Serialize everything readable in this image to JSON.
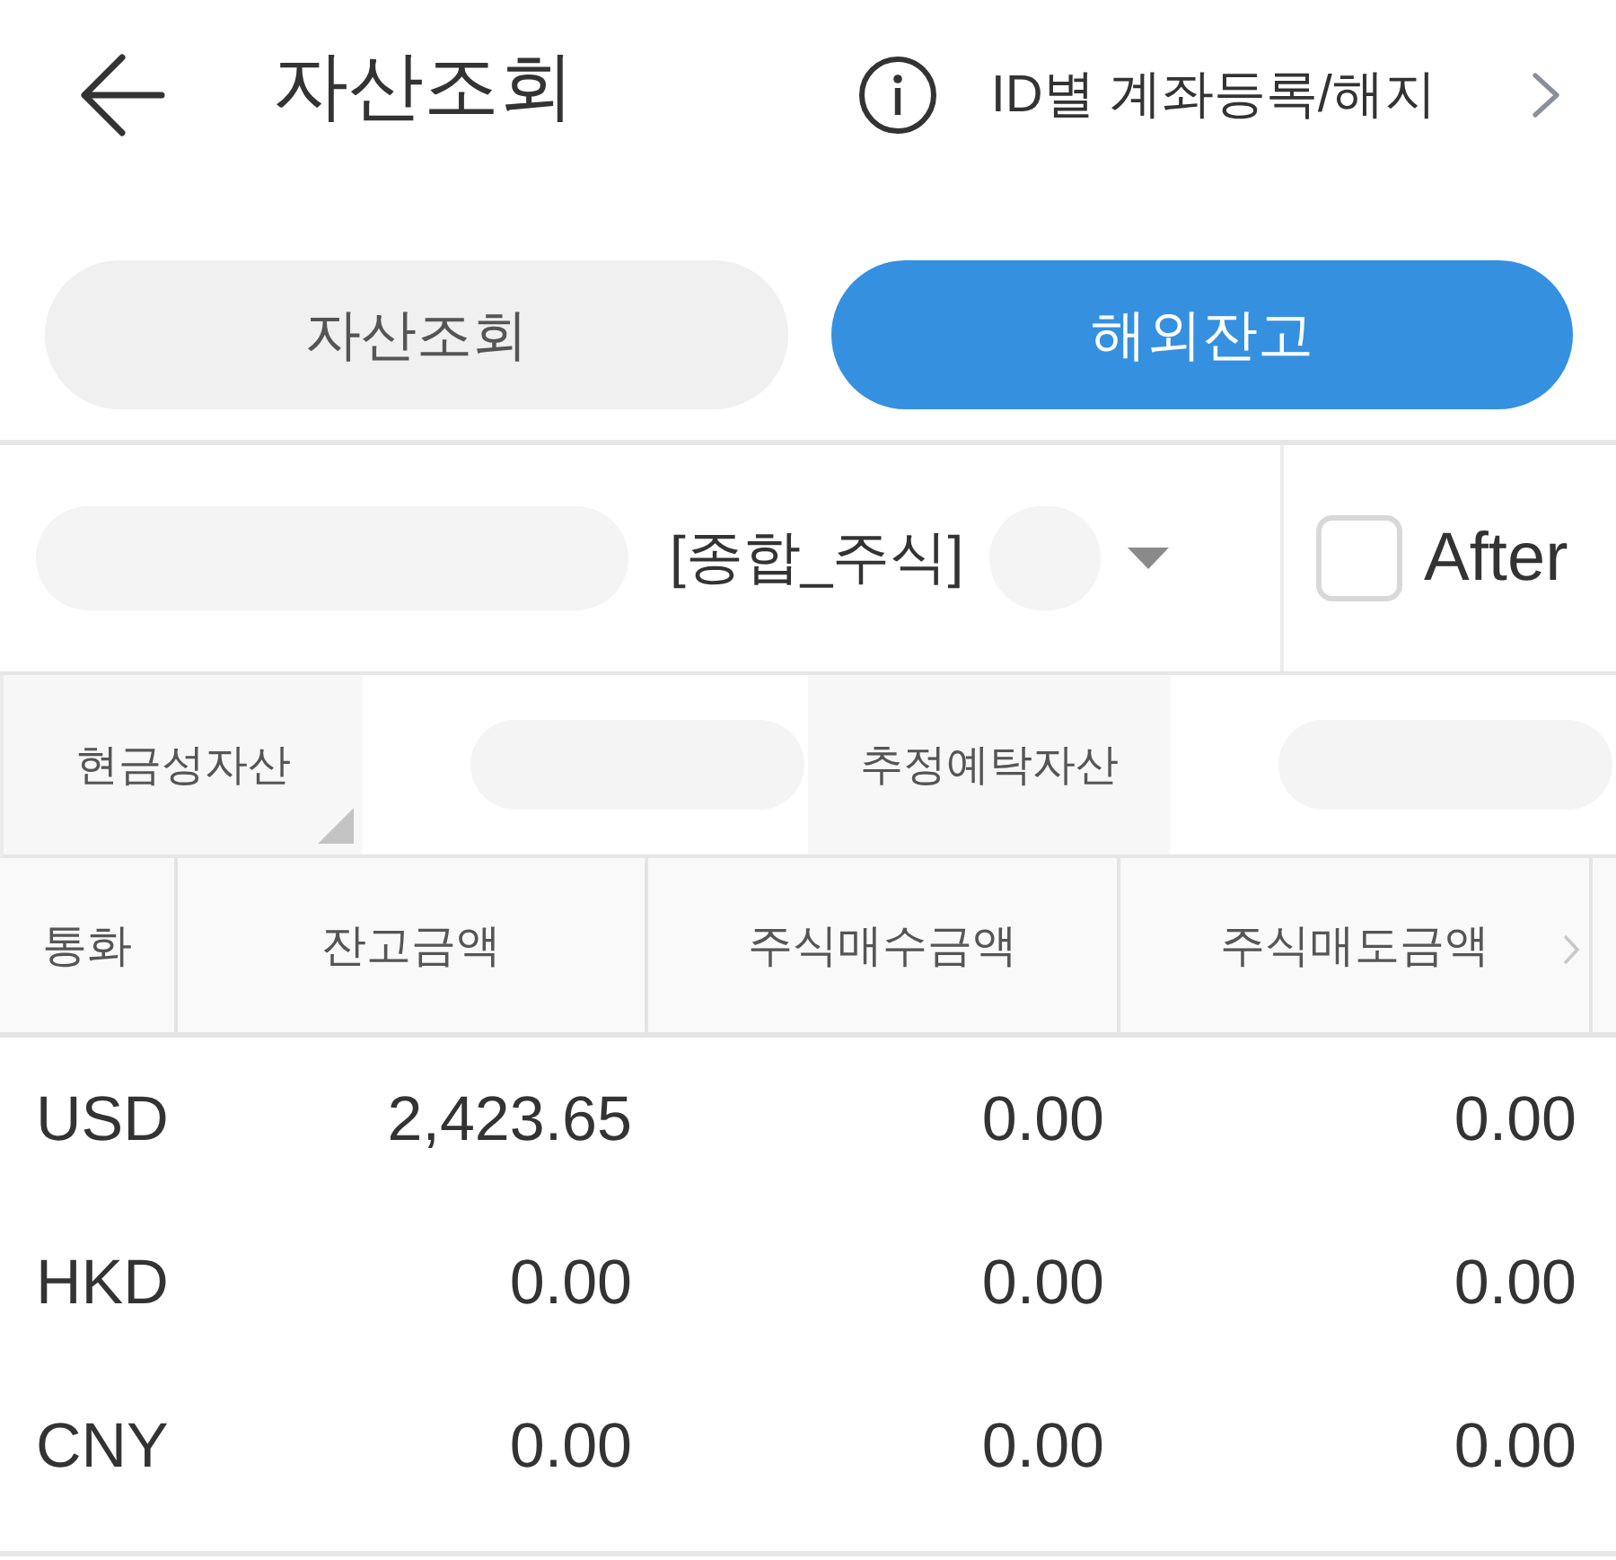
{
  "header": {
    "title": "자산조회",
    "link": "ID별 계좌등록/해지"
  },
  "tabs": [
    {
      "label": "자산조회",
      "selected": false
    },
    {
      "label": "해외잔고",
      "selected": true
    }
  ],
  "account": {
    "label": "[종합_주식]",
    "masked": true
  },
  "after": {
    "label": "After",
    "checked": false
  },
  "summary": [
    {
      "label": "현금성자산",
      "expandable": true,
      "masked": true
    },
    {
      "label": "추정예탁자산",
      "expandable": false,
      "masked": true
    }
  ],
  "table": {
    "columns": [
      "통화",
      "잔고금액",
      "주식매수금액",
      "주식매도금액"
    ],
    "rows": [
      [
        "USD",
        "2,423.65",
        "0.00",
        "0.00"
      ],
      [
        "HKD",
        "0.00",
        "0.00",
        "0.00"
      ],
      [
        "CNY",
        "0.00",
        "0.00",
        "0.00"
      ]
    ]
  }
}
